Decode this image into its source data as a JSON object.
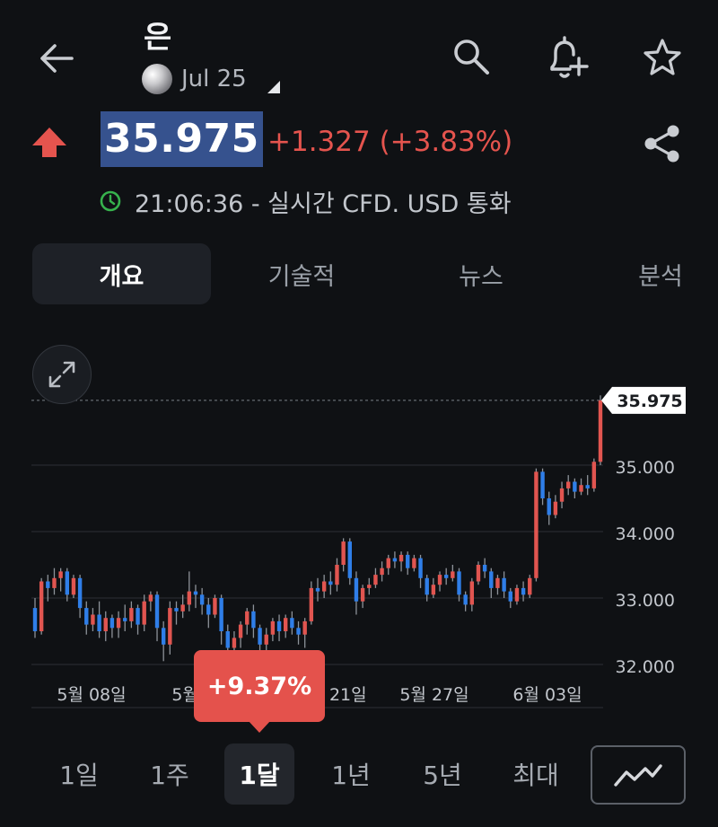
{
  "header": {
    "title": "은",
    "contract": "Jul 25"
  },
  "quote": {
    "price": "35.975",
    "change": "+1.327 (+3.83%)",
    "time_info": "21:06:36 - 실시간 CFD. USD 통화"
  },
  "tabs": [
    {
      "label": "개요",
      "active": true
    },
    {
      "label": "기술적",
      "active": false
    },
    {
      "label": "뉴스",
      "active": false
    },
    {
      "label": "분석",
      "active": false
    }
  ],
  "chart_data": {
    "type": "candlestick",
    "x_tick_labels": [
      "5월 08일",
      "5월 15일",
      "5월 21일",
      "5월 27일",
      "6월 03일"
    ],
    "y_tick_labels": [
      "35.000",
      "34.000",
      "33.000",
      "32.000"
    ],
    "ylim": [
      31.3,
      36.5
    ],
    "current_price_label": "35.975",
    "current_price": 35.975,
    "colors": {
      "up": "#e15550",
      "down": "#2f7ee8"
    },
    "candles": [
      [
        32.85,
        32.5,
        33.0,
        32.4
      ],
      [
        32.5,
        33.25,
        33.3,
        32.45
      ],
      [
        33.25,
        33.15,
        33.35,
        32.95
      ],
      [
        33.15,
        33.3,
        33.45,
        33.05
      ],
      [
        33.3,
        33.4,
        33.45,
        33.1
      ],
      [
        33.4,
        33.05,
        33.45,
        32.95
      ],
      [
        33.05,
        33.3,
        33.35,
        33.0
      ],
      [
        33.3,
        32.85,
        33.35,
        32.7
      ],
      [
        32.85,
        32.6,
        32.95,
        32.45
      ],
      [
        32.6,
        32.75,
        32.85,
        32.5
      ],
      [
        32.75,
        32.5,
        32.95,
        32.4
      ],
      [
        32.5,
        32.7,
        32.8,
        32.35
      ],
      [
        32.7,
        32.55,
        32.75,
        32.4
      ],
      [
        32.55,
        32.7,
        32.8,
        32.4
      ],
      [
        32.7,
        32.65,
        32.9,
        32.5
      ],
      [
        32.65,
        32.85,
        32.95,
        32.55
      ],
      [
        32.85,
        32.6,
        32.9,
        32.45
      ],
      [
        32.6,
        32.95,
        33.05,
        32.5
      ],
      [
        32.95,
        33.05,
        33.1,
        32.8
      ],
      [
        33.05,
        32.55,
        33.1,
        32.35
      ],
      [
        32.55,
        32.3,
        32.65,
        32.05
      ],
      [
        32.3,
        32.85,
        32.95,
        32.15
      ],
      [
        32.85,
        32.8,
        32.95,
        32.6
      ],
      [
        32.8,
        32.9,
        33.05,
        32.7
      ],
      [
        32.9,
        33.1,
        33.4,
        32.8
      ],
      [
        33.1,
        33.05,
        33.2,
        32.85
      ],
      [
        33.05,
        32.9,
        33.15,
        32.75
      ],
      [
        32.9,
        32.75,
        33.0,
        32.55
      ],
      [
        32.75,
        33.0,
        33.05,
        32.7
      ],
      [
        33.0,
        32.5,
        33.05,
        32.3
      ],
      [
        32.5,
        32.25,
        32.6,
        32.1
      ],
      [
        32.25,
        32.4,
        32.5,
        32.05
      ],
      [
        32.4,
        32.6,
        32.65,
        32.25
      ],
      [
        32.6,
        32.8,
        32.85,
        32.45
      ],
      [
        32.8,
        32.55,
        32.9,
        32.4
      ],
      [
        32.55,
        32.3,
        32.6,
        32.2
      ],
      [
        32.3,
        32.45,
        32.55,
        32.2
      ],
      [
        32.45,
        32.65,
        32.7,
        32.35
      ],
      [
        32.65,
        32.5,
        32.75,
        32.35
      ],
      [
        32.5,
        32.7,
        32.75,
        32.4
      ],
      [
        32.7,
        32.55,
        32.8,
        32.45
      ],
      [
        32.55,
        32.45,
        32.65,
        32.3
      ],
      [
        32.45,
        32.65,
        32.7,
        32.25
      ],
      [
        32.65,
        33.15,
        33.25,
        32.6
      ],
      [
        33.15,
        33.1,
        33.3,
        32.95
      ],
      [
        33.1,
        33.25,
        33.35,
        33.0
      ],
      [
        33.25,
        33.2,
        33.4,
        33.05
      ],
      [
        33.2,
        33.5,
        33.6,
        33.1
      ],
      [
        33.5,
        33.85,
        33.9,
        33.4
      ],
      [
        33.85,
        33.3,
        33.9,
        33.2
      ],
      [
        33.3,
        32.95,
        33.4,
        32.75
      ],
      [
        32.95,
        33.15,
        33.2,
        32.85
      ],
      [
        33.15,
        33.2,
        33.3,
        33.05
      ],
      [
        33.2,
        33.35,
        33.45,
        33.15
      ],
      [
        33.35,
        33.45,
        33.55,
        33.25
      ],
      [
        33.45,
        33.6,
        33.65,
        33.35
      ],
      [
        33.6,
        33.55,
        33.7,
        33.45
      ],
      [
        33.55,
        33.65,
        33.7,
        33.4
      ],
      [
        33.65,
        33.45,
        33.7,
        33.35
      ],
      [
        33.45,
        33.6,
        33.65,
        33.4
      ],
      [
        33.6,
        33.3,
        33.65,
        33.15
      ],
      [
        33.3,
        33.05,
        33.35,
        32.95
      ],
      [
        33.05,
        33.2,
        33.3,
        33.0
      ],
      [
        33.2,
        33.35,
        33.4,
        33.1
      ],
      [
        33.35,
        33.3,
        33.45,
        33.2
      ],
      [
        33.3,
        33.4,
        33.5,
        33.25
      ],
      [
        33.4,
        33.05,
        33.45,
        32.95
      ],
      [
        33.05,
        32.9,
        33.1,
        32.8
      ],
      [
        32.9,
        33.25,
        33.3,
        32.8
      ],
      [
        33.25,
        33.5,
        33.55,
        33.2
      ],
      [
        33.5,
        33.4,
        33.6,
        33.3
      ],
      [
        33.4,
        33.15,
        33.45,
        33.0
      ],
      [
        33.15,
        33.3,
        33.35,
        33.05
      ],
      [
        33.3,
        33.1,
        33.4,
        33.0
      ],
      [
        33.1,
        32.95,
        33.15,
        32.85
      ],
      [
        32.95,
        33.15,
        33.2,
        32.9
      ],
      [
        33.15,
        33.05,
        33.25,
        32.95
      ],
      [
        33.05,
        33.3,
        33.35,
        33.0
      ],
      [
        33.3,
        34.9,
        34.95,
        33.25
      ],
      [
        34.9,
        34.5,
        34.95,
        34.4
      ],
      [
        34.5,
        34.25,
        34.6,
        34.1
      ],
      [
        34.25,
        34.45,
        34.55,
        34.2
      ],
      [
        34.45,
        34.65,
        34.75,
        34.35
      ],
      [
        34.65,
        34.75,
        34.85,
        34.55
      ],
      [
        34.75,
        34.6,
        34.8,
        34.5
      ],
      [
        34.6,
        34.7,
        34.8,
        34.55
      ],
      [
        34.7,
        34.65,
        34.85,
        34.55
      ],
      [
        34.65,
        35.05,
        35.1,
        34.6
      ],
      [
        35.05,
        35.975,
        36.05,
        35.0
      ]
    ],
    "grid": true
  },
  "period_tooltip": "+9.37%",
  "periods": [
    {
      "label": "1일",
      "active": false
    },
    {
      "label": "1주",
      "active": false
    },
    {
      "label": "1달",
      "active": true
    },
    {
      "label": "1년",
      "active": false
    },
    {
      "label": "5년",
      "active": false
    },
    {
      "label": "최대",
      "active": false
    }
  ],
  "icons": {
    "back": "arrow-left-icon",
    "search": "search-icon",
    "alert": "bell-plus-icon",
    "watchlist": "star-icon",
    "share": "share-icon",
    "direction": "arrow-up-icon",
    "clock": "clock-icon",
    "expand": "expand-icon",
    "chart_type": "line-chart-icon"
  }
}
